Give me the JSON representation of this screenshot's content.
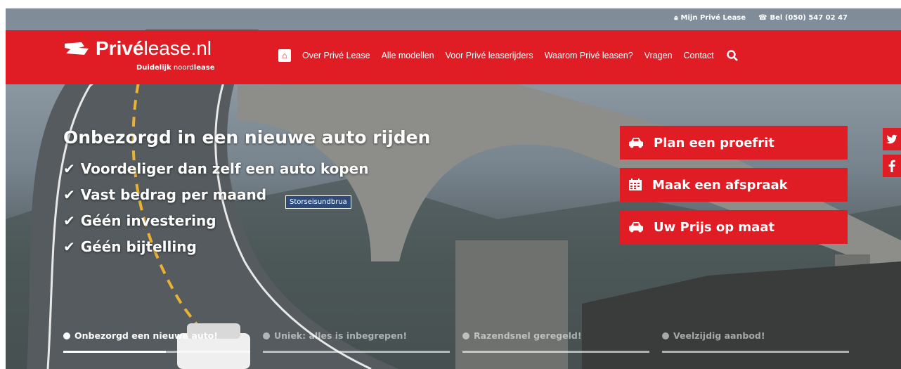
{
  "topbar": {
    "account_label": "Mijn Privé Lease",
    "phone_label": "Bel (050) 547 02 47"
  },
  "logo": {
    "brand_bold": "Privé",
    "brand_light": "lease.nl",
    "tagline_bold": "Duidelijk",
    "tagline_light": "noord",
    "tagline_end": "lease"
  },
  "nav": {
    "items": [
      {
        "label": "Over Privé Lease"
      },
      {
        "label": "Alle modellen"
      },
      {
        "label": "Voor Privé leaserijders"
      },
      {
        "label": "Waarom Privé leasen?"
      },
      {
        "label": "Vragen"
      },
      {
        "label": "Contact"
      }
    ]
  },
  "hero": {
    "title": "Onbezorgd in een nieuwe auto rijden",
    "benefits": [
      "Voordeliger dan zelf een auto kopen",
      "Vast bedrag per maand",
      "Géén investering",
      "Géén bijtelling"
    ],
    "sign": "Storseisundbrua"
  },
  "cta": {
    "buttons": [
      {
        "label": "Plan een proefrit",
        "icon": "car-icon"
      },
      {
        "label": "Maak een afspraak",
        "icon": "calendar-icon"
      },
      {
        "label": "Uw Prijs op maat",
        "icon": "car-icon"
      }
    ]
  },
  "social": {
    "twitter": "twitter-icon",
    "facebook": "facebook-icon"
  },
  "slider": {
    "tabs": [
      {
        "label": "Onbezorgd een nieuwe auto!",
        "active": true,
        "progress": 0.55
      },
      {
        "label": "Uniek: alles is inbegrepen!",
        "active": false,
        "progress": 0
      },
      {
        "label": "Razendsnel geregeld!",
        "active": false,
        "progress": 0
      },
      {
        "label": "Veelzijdig aanbod!",
        "active": false,
        "progress": 0
      }
    ]
  },
  "colors": {
    "brand_red": "#e01c24",
    "white": "#ffffff",
    "sign_blue": "#2c4a7c"
  }
}
